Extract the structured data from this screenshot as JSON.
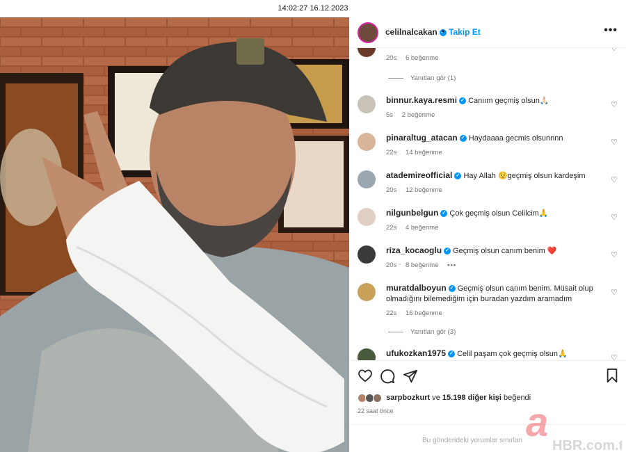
{
  "screen": {
    "timestamp": "14:02:27 16.12.2023"
  },
  "post": {
    "author": "celilnalcakan",
    "separator": "•",
    "follow_label": "Takip Et",
    "more_label": "•••"
  },
  "comments": [
    {
      "username": "",
      "text": "",
      "time": "20s",
      "likes": "6 beğenme",
      "avatar_color": "#6b3a2a",
      "partial": true
    },
    {
      "username": "binnur.kaya.resmi",
      "text": "Canıım geçmiş olsun🙏🏻",
      "time": "5s",
      "likes": "2 beğenme",
      "avatar_color": "#c9c2b8"
    },
    {
      "username": "pinaraltug_atacan",
      "text": "Haydaaaa gecmis olsunnnn",
      "time": "22s",
      "likes": "14 beğenme",
      "avatar_color": "#d8b49a"
    },
    {
      "username": "atademireofficial",
      "text": "Hay Allah 😟geçmiş olsun kardeşim",
      "time": "20s",
      "likes": "12 beğenme",
      "avatar_color": "#9aa6b0"
    },
    {
      "username": "nilgunbelgun",
      "text": "Çok geçmiş olsun Celilcim🙏",
      "time": "22s",
      "likes": "4 beğenme",
      "avatar_color": "#e2cfc4"
    },
    {
      "username": "riza_kocaoglu",
      "text": "Geçmiş olsun canım benim ❤️",
      "time": "20s",
      "likes": "8 beğenme",
      "extra": "•••",
      "avatar_color": "#3a3a3a"
    },
    {
      "username": "muratdalboyun",
      "text": "Geçmiş olsun canım benim. Müsait olup olmadığını bilemediğim için buradan yazdım aramadım",
      "time": "22s",
      "likes": "16 beğenme",
      "avatar_color": "#caa15a"
    },
    {
      "username": "ufukozkan1975",
      "text": "Celil paşam çok geçmiş olsun🙏",
      "time": "",
      "likes": "",
      "avatar_color": "#4a5a3c"
    }
  ],
  "replies": [
    {
      "label": "Yanıtları gör (1)"
    },
    {
      "label": "Yanıtları gör (3)"
    }
  ],
  "actions": {
    "like": "heart-outline-icon",
    "comment": "comment-icon",
    "share": "send-icon",
    "save": "bookmark-icon"
  },
  "likes_summary": {
    "first_user": "sarpbozkurt",
    "connector": "ve",
    "others": "15.198 diğer kişi",
    "suffix": "beğendi"
  },
  "posted_ago": "22 saat önce",
  "footer_text": "Bu gönderideki yorumlar sınırlan",
  "watermark": "HBR.com.tr",
  "colors": {
    "accent": "#0095f6",
    "heart_red": "#ed4956",
    "watermark_red": "#e30613"
  }
}
